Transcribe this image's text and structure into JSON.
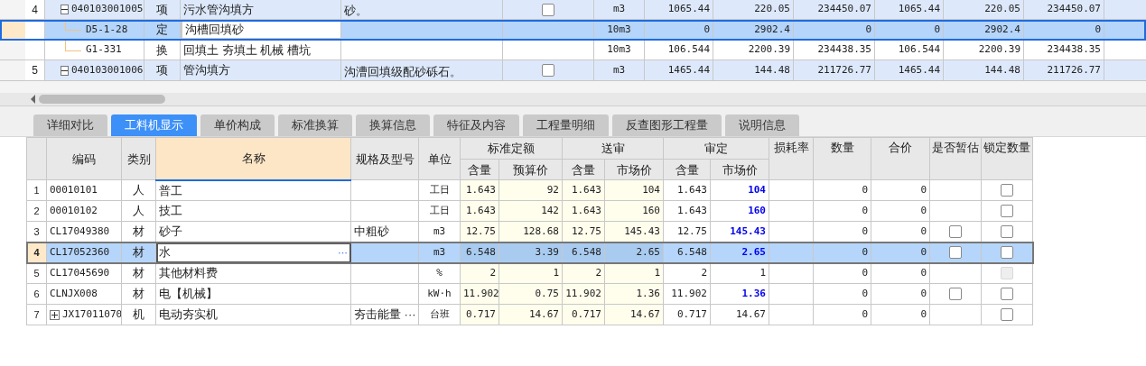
{
  "tree": {
    "rows": [
      {
        "no": "4",
        "kind": "item",
        "expanded": true,
        "code": "040103001005",
        "type": "项",
        "name": "污水管沟填方",
        "feature": "砂。",
        "checked": false,
        "selected": false,
        "unit": "m3",
        "values": [
          "1065.44",
          "220.05",
          "234450.07",
          "1065.44",
          "220.05",
          "234450.07"
        ],
        "children": [
          {
            "kind": "quota",
            "code": "D5-1-28",
            "type": "定",
            "name": "沟槽回填砂",
            "selected": true,
            "unit": "10m3",
            "values": [
              "0",
              "2902.4",
              "0",
              "0",
              "2902.4",
              "0"
            ]
          },
          {
            "kind": "quota",
            "code": "G1-331",
            "type": "换",
            "name": "回填土 夯填土 机械 槽坑",
            "selected": false,
            "unit": "10m3",
            "values": [
              "106.544",
              "2200.39",
              "234438.35",
              "106.544",
              "2200.39",
              "234438.35"
            ]
          }
        ]
      },
      {
        "no": "5",
        "kind": "item",
        "expanded": true,
        "code": "040103001006",
        "type": "项",
        "name": "管沟填方",
        "feature": "沟漕回填级配砂砾石。",
        "checked": false,
        "selected": false,
        "unit": "m3",
        "values": [
          "1465.44",
          "144.48",
          "211726.77",
          "1465.44",
          "144.48",
          "211726.77"
        ],
        "children": []
      }
    ]
  },
  "tabs": [
    {
      "label": "详细对比",
      "selected": false
    },
    {
      "label": "工料机显示",
      "selected": true
    },
    {
      "label": "单价构成",
      "selected": false
    },
    {
      "label": "标准换算",
      "selected": false
    },
    {
      "label": "换算信息",
      "selected": false
    },
    {
      "label": "特征及内容",
      "selected": false
    },
    {
      "label": "工程量明细",
      "selected": false
    },
    {
      "label": "反查图形工程量",
      "selected": false
    },
    {
      "label": "说明信息",
      "selected": false
    }
  ],
  "table": {
    "columns": [
      "编码",
      "类别",
      "名称",
      "规格及型号",
      "单位",
      "损耗率",
      "数量",
      "合价",
      "是否暂估",
      "锁定数量"
    ],
    "groups": [
      {
        "title": "标准定额",
        "sub": [
          "含量",
          "预算价"
        ]
      },
      {
        "title": "送审",
        "sub": [
          "含量",
          "市场价"
        ]
      },
      {
        "title": "审定",
        "sub": [
          "含量",
          "市场价"
        ]
      }
    ],
    "rows": [
      {
        "no": "1",
        "code": "00010101",
        "expandable": false,
        "type": "人",
        "name": "普工",
        "spec": "",
        "unit": "工日",
        "std_qty": "1.643",
        "std_price": "92",
        "sub_qty": "1.643",
        "sub_price": "104",
        "app_qty": "1.643",
        "app_price": "104",
        "app_price_changed": true,
        "qty": "0",
        "total": "0",
        "provisional": null,
        "lock": {
          "checked": false,
          "disabled": false
        },
        "selected": false
      },
      {
        "no": "2",
        "code": "00010102",
        "expandable": false,
        "type": "人",
        "name": "技工",
        "spec": "",
        "unit": "工日",
        "std_qty": "1.643",
        "std_price": "142",
        "sub_qty": "1.643",
        "sub_price": "160",
        "app_qty": "1.643",
        "app_price": "160",
        "app_price_changed": true,
        "qty": "0",
        "total": "0",
        "provisional": null,
        "lock": {
          "checked": false,
          "disabled": false
        },
        "selected": false
      },
      {
        "no": "3",
        "code": "CL17049380",
        "expandable": false,
        "type": "材",
        "name": "砂子",
        "spec": "中粗砂",
        "unit": "m3",
        "std_qty": "12.75",
        "std_price": "128.68",
        "sub_qty": "12.75",
        "sub_price": "145.43",
        "app_qty": "12.75",
        "app_price": "145.43",
        "app_price_changed": true,
        "qty": "0",
        "total": "0",
        "provisional": {
          "checked": false
        },
        "lock": {
          "checked": false,
          "disabled": false
        },
        "selected": false
      },
      {
        "no": "4",
        "code": "CL17052360",
        "expandable": false,
        "type": "材",
        "name": "水",
        "name_more": "···",
        "spec": "",
        "unit": "m3",
        "std_qty": "6.548",
        "std_price": "3.39",
        "sub_qty": "6.548",
        "sub_price": "2.65",
        "app_qty": "6.548",
        "app_price": "2.65",
        "app_price_changed": true,
        "qty": "0",
        "total": "0",
        "provisional": {
          "checked": false
        },
        "lock": {
          "checked": false,
          "disabled": false
        },
        "selected": true
      },
      {
        "no": "5",
        "code": "CL17045690",
        "expandable": false,
        "type": "材",
        "name": "其他材料费",
        "spec": "",
        "unit": "%",
        "std_qty": "2",
        "std_price": "1",
        "sub_qty": "2",
        "sub_price": "1",
        "app_qty": "2",
        "app_price": "1",
        "app_price_changed": false,
        "qty": "0",
        "total": "0",
        "provisional": null,
        "lock": {
          "checked": false,
          "disabled": true
        },
        "selected": false
      },
      {
        "no": "6",
        "code": "CLNJX008",
        "expandable": false,
        "type": "材",
        "name": "电【机械】",
        "spec": "",
        "unit": "kW·h",
        "std_qty": "11.902",
        "std_price": "0.75",
        "sub_qty": "11.902",
        "sub_price": "1.36",
        "app_qty": "11.902",
        "app_price": "1.36",
        "app_price_changed": true,
        "qty": "0",
        "total": "0",
        "provisional": {
          "checked": false
        },
        "lock": {
          "checked": false,
          "disabled": false
        },
        "selected": false
      },
      {
        "no": "7",
        "code": "JX17011070",
        "expandable": true,
        "type": "机",
        "name": "电动夯实机",
        "spec": "夯击能量 ···",
        "unit": "台班",
        "std_qty": "0.717",
        "std_price": "14.67",
        "sub_qty": "0.717",
        "sub_price": "14.67",
        "app_qty": "0.717",
        "app_price": "14.67",
        "app_price_changed": false,
        "qty": "0",
        "total": "0",
        "provisional": null,
        "lock": {
          "checked": false,
          "disabled": false
        },
        "selected": false
      }
    ]
  }
}
